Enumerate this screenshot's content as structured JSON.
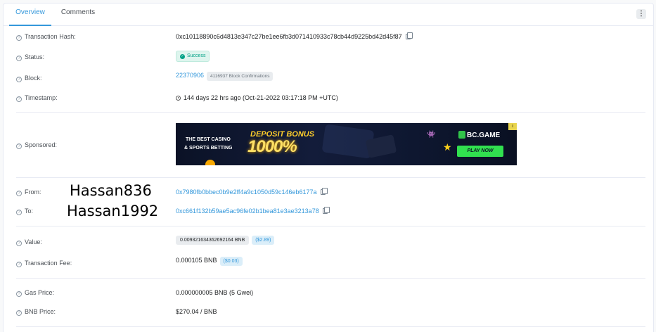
{
  "tabs": {
    "overview": "Overview",
    "comments": "Comments"
  },
  "more_icon": "⋮",
  "rows": {
    "hash": {
      "label": "Transaction Hash:",
      "value": "0xc10118890c6d4813e347c27be1ee6fb3d071410933c78cb44d9225bd42d45f87"
    },
    "status": {
      "label": "Status:",
      "value": "Success"
    },
    "block": {
      "label": "Block:",
      "number": "22370906",
      "confirmations": "4116937 Block Confirmations"
    },
    "timestamp": {
      "label": "Timestamp:",
      "value": "144 days 22 hrs ago (Oct-21-2022 03:17:18 PM +UTC)"
    },
    "sponsored": {
      "label": "Sponsored:"
    },
    "from": {
      "label": "From:",
      "value": "0x7980fb0bbec0b9e2ff4a9c1050d59c146eb6177a",
      "handwritten": "Hassan836"
    },
    "to": {
      "label": "To:",
      "value": "0xc661f132b59ae5ac96fe02b1bea81e3ae3213a78",
      "handwritten": "Hassan1992"
    },
    "value": {
      "label": "Value:",
      "amount": "0.009321634362692164 BNB",
      "usd": "($2.89)"
    },
    "fee": {
      "label": "Transaction Fee:",
      "amount": "0.000105 BNB",
      "usd": "($0.03)"
    },
    "gas": {
      "label": "Gas Price:",
      "value": "0.000000005 BNB (5 Gwei)"
    },
    "bnb": {
      "label": "BNB Price:",
      "value": "$270.04 / BNB"
    }
  },
  "ad": {
    "line1": "THE BEST CASINO",
    "line2": "& SPORTS BETTING",
    "bonus": "DEPOSIT BONUS",
    "percent": "1000%",
    "brand": "BC.GAME",
    "cta": "PLAY NOW",
    "adchoice": "i"
  },
  "colors": {
    "accent": "#3498db",
    "success": "#00a186",
    "ad_cta": "#31e04f"
  }
}
